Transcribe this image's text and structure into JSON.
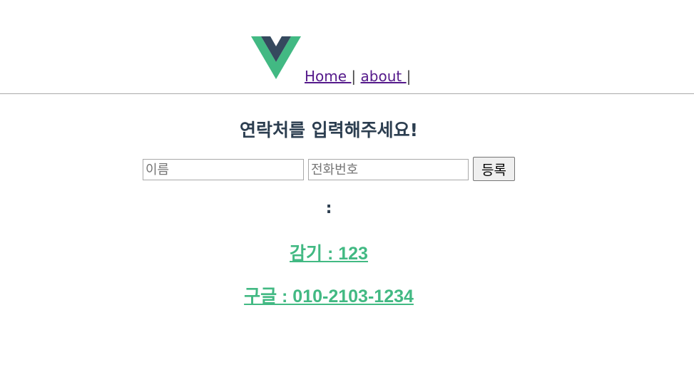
{
  "nav": {
    "logo": "vue-logo",
    "links": [
      {
        "label": "Home "
      },
      {
        "label": "about "
      }
    ],
    "separator": "|"
  },
  "main": {
    "title": "연락처를 입력해주세요!",
    "form": {
      "name_placeholder": "이름",
      "phone_placeholder": "전화번호",
      "submit_label": "등록"
    },
    "selected_text": ":",
    "contacts": [
      {
        "text": "감기 : 123"
      },
      {
        "text": "구글 : 010-2103-1234"
      }
    ]
  },
  "colors": {
    "vue_green": "#42b983",
    "vue_dark": "#35495e",
    "heading": "#2c3e50",
    "link_visited": "#551a8b"
  }
}
